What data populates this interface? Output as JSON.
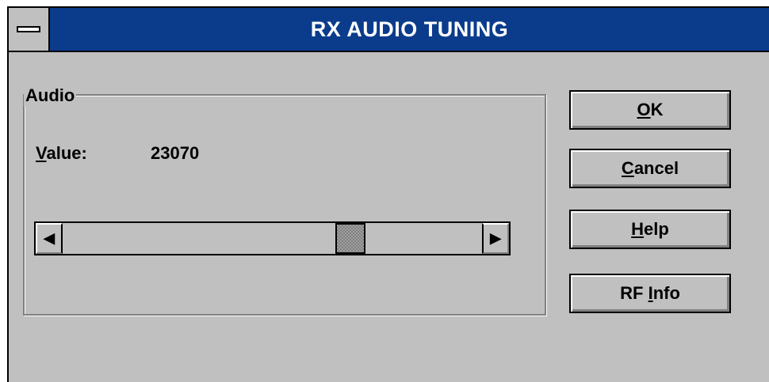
{
  "window": {
    "title": "RX AUDIO TUNING",
    "title_bar_color": "#0b3c8c",
    "system_menu_icon": "system-menu-icon"
  },
  "group": {
    "label": "Audio"
  },
  "value": {
    "label_mnemonic": "V",
    "label_rest": "alue:",
    "text": "23070"
  },
  "scrollbar": {
    "left_arrow": "🠔",
    "right_arrow": "🠖",
    "position_fraction": 0.7
  },
  "buttons": {
    "ok": {
      "mnemonic": "O",
      "rest": "K"
    },
    "cancel": {
      "mnemonic": "C",
      "rest": "ancel"
    },
    "help": {
      "mnemonic": "H",
      "rest": "elp"
    },
    "rf_info": {
      "prefix": "RF ",
      "mnemonic": "I",
      "rest": "nfo"
    }
  }
}
